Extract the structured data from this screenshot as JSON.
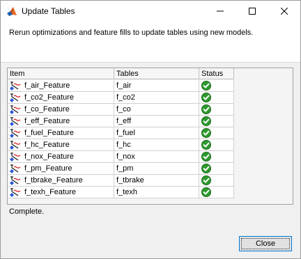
{
  "window": {
    "title": "Update Tables",
    "controls": [
      "minimize-icon",
      "maximize-icon",
      "close-icon"
    ]
  },
  "subtitle": "Rerun optimizations and feature fills to update tables using new models.",
  "table": {
    "headers": [
      "Item",
      "Tables",
      "Status"
    ],
    "rows": [
      {
        "item": "f_air_Feature",
        "table": "f_air",
        "status": "ok"
      },
      {
        "item": "f_co2_Feature",
        "table": "f_co2",
        "status": "ok"
      },
      {
        "item": "f_co_Feature",
        "table": "f_co",
        "status": "ok"
      },
      {
        "item": "f_eff_Feature",
        "table": "f_eff",
        "status": "ok"
      },
      {
        "item": "f_fuel_Feature",
        "table": "f_fuel",
        "status": "ok"
      },
      {
        "item": "f_hc_Feature",
        "table": "f_hc",
        "status": "ok"
      },
      {
        "item": "f_nox_Feature",
        "table": "f_nox",
        "status": "ok"
      },
      {
        "item": "f_pm_Feature",
        "table": "f_pm",
        "status": "ok"
      },
      {
        "item": "f_tbrake_Feature",
        "table": "f_tbrake",
        "status": "ok"
      },
      {
        "item": "f_texh_Feature",
        "table": "f_texh",
        "status": "ok"
      }
    ]
  },
  "status_text": "Complete.",
  "buttons": {
    "close_label": "Close"
  },
  "colors": {
    "ok": "#2e9a2e",
    "accent": "#0078d7"
  }
}
